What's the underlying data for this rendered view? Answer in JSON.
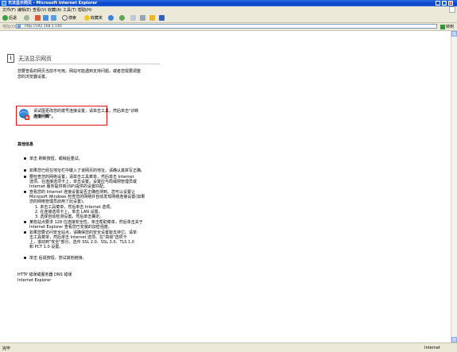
{
  "window": {
    "title": "无法显示网页 - Microsoft Internet Explorer"
  },
  "menu": [
    "文件(F)",
    "编辑(E)",
    "查看(V)",
    "收藏(A)",
    "工具(T)",
    "帮助(H)"
  ],
  "toolbar": {
    "back": "后退",
    "search": "搜索",
    "favorites": "收藏夹"
  },
  "address": {
    "label": "地址(D)",
    "url": "http://192.168.1.140",
    "go": "转到"
  },
  "page": {
    "heading": "无法显示网页",
    "intro_lines": [
      "您要查看的网页当前不可用。网站可能遇到支持问题，或者您需要调整",
      "您的浏览器设置。"
    ],
    "callout_lines": [
      "请试图更改您的拨号连接设置，请单击工具，然后单击\"诊断",
      "连接问题\"。"
    ],
    "section_title": "其他信息",
    "bullets": [
      "单击  刷新按钮，或稍后重试。",
      "如果您已经在地址栏中键入了该网页的地址，请确认其拼写正确。",
      "要检查您的网络设置，请单击工具菜单，然后单击 Internet",
      "选项。在连接选项卡上，单击设置。设置应与局域网管理员或",
      "Internet 服务提供商(ISP)提供的设置匹配。",
      "查看您的 Internet 连接设置是否正确检测到。您可以设置让",
      "Microsoft Windows 检查您的网络并自动发现网络连接设置(如果",
      "您的网络管理员启用了此设置)。"
    ],
    "numbered": [
      "1.  单击工具菜单，然后单击 Internet 选项。",
      "2.  在连接选项卡上，单击 LAN 设置。",
      "3.  选择自动检测设置，然后单击确定。"
    ],
    "more_lines": [
      "某些站点要求 128 位连接安全性。单击帮助菜单，然后单击关于",
      "Internet Explorer 查看您已安装的加密强度。",
      "如果您要访问安全站点，请确保您的安全设置能支持它。请单",
      "击工具菜单，然后单击 Internet 选项。在\"高级\"选项卡",
      "上，滚动到\"安全\"部分，选中 SSL 2.0、SSL 3.0、TLS 1.0",
      "和 PCT 1.0 设置。",
      "单击 后退按钮，尝试其他链接。"
    ],
    "back_link": "后退",
    "footer_lines": [
      "HTTP 错误或服务器 DNS 错误",
      "Internet Explorer"
    ]
  },
  "status": {
    "left": "完毕",
    "right": "Internet"
  }
}
